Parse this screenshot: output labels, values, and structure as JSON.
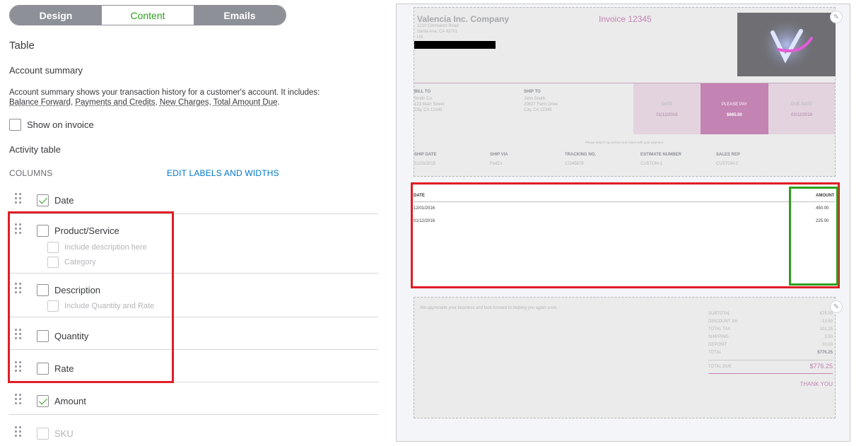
{
  "tabs": [
    {
      "label": "Design"
    },
    {
      "label": "Content"
    },
    {
      "label": "Emails"
    }
  ],
  "panel": {
    "title": "Table",
    "account_summary": {
      "heading": "Account summary",
      "description_line1": "Account summary shows your transaction history for a customer's account. It includes:",
      "items": [
        "Balance Forward",
        "Payments and Credits",
        "New Charges",
        "Total Amount Due"
      ],
      "show_label": "Show on invoice",
      "show_checked": false
    },
    "activity_heading": "Activity table",
    "columns_heading": "COLUMNS",
    "edit_link": "EDIT LABELS AND WIDTHS",
    "columns": [
      {
        "label": "Date",
        "checked": true
      },
      {
        "label": "Product/Service",
        "checked": false,
        "subs": [
          "Include description here",
          "Category"
        ]
      },
      {
        "label": "Description",
        "checked": false,
        "subs": [
          "Include Quantity and Rate"
        ]
      },
      {
        "label": "Quantity",
        "checked": false
      },
      {
        "label": "Rate",
        "checked": false
      },
      {
        "label": "Amount",
        "checked": true
      },
      {
        "label": "SKU",
        "checked": false,
        "disabled": true
      }
    ]
  },
  "invoice": {
    "company": "Valencia Inc. Company",
    "address": [
      "1210 Cimmaron Road",
      "Santa Ana, CA 92701",
      "US"
    ],
    "invoice_title": "Invoice 12345",
    "bill_to": {
      "label": "BILL TO",
      "lines": [
        "Smith Co.",
        "123 Main Street",
        "City, CA 12345"
      ]
    },
    "ship_to": {
      "label": "SHIP TO",
      "lines": [
        "John Smith",
        "20637 Farm Drive",
        "City, CA 12345"
      ]
    },
    "date": {
      "label": "DATE",
      "value": "01/12/2016"
    },
    "please_pay": {
      "label": "PLEASE PAY",
      "value": "$665.00"
    },
    "due_date": {
      "label": "DUE DATE",
      "value": "02/12/2016"
    },
    "detach_note": "Please detach top portion and return with your payment.",
    "ship_fields": [
      {
        "label": "SHIP DATE",
        "value": "01/03/2015"
      },
      {
        "label": "SHIP VIA",
        "value": "FedEx"
      },
      {
        "label": "TRACKING NO.",
        "value": "12345678"
      },
      {
        "label": "ESTIMATE NUMBER",
        "value": "CUSTOM-1"
      },
      {
        "label": "SALES REP",
        "value": "CUSTOM-2"
      }
    ],
    "table": {
      "headers": [
        "DATE",
        "AMOUNT"
      ],
      "rows": [
        {
          "date": "12/01/2016",
          "amount": "450.00"
        },
        {
          "date": "01/12/2016",
          "amount": "225.00"
        }
      ]
    },
    "footer_message": "We appreciate your business and look forward to helping you again soon.",
    "totals": [
      {
        "label": "SUBTOTAL",
        "value": "675.00"
      },
      {
        "label": "DISCOUNT 2%",
        "value": "-13.50"
      },
      {
        "label": "TOTAL TAX",
        "value": "101.25"
      },
      {
        "label": "SHIPPING",
        "value": "3.50"
      },
      {
        "label": "DEPOSIT",
        "value": "10.00"
      },
      {
        "label": "TOTAL",
        "value": "$776.25"
      }
    ],
    "total_due": {
      "label": "TOTAL DUE",
      "value": "$776.25"
    },
    "thank_you": "THANK YOU"
  },
  "colors": {
    "accent_green": "#2ca01c",
    "link_blue": "#0077c5",
    "highlight_red": "#e01e26",
    "invoice_pink": "#c383b3"
  }
}
